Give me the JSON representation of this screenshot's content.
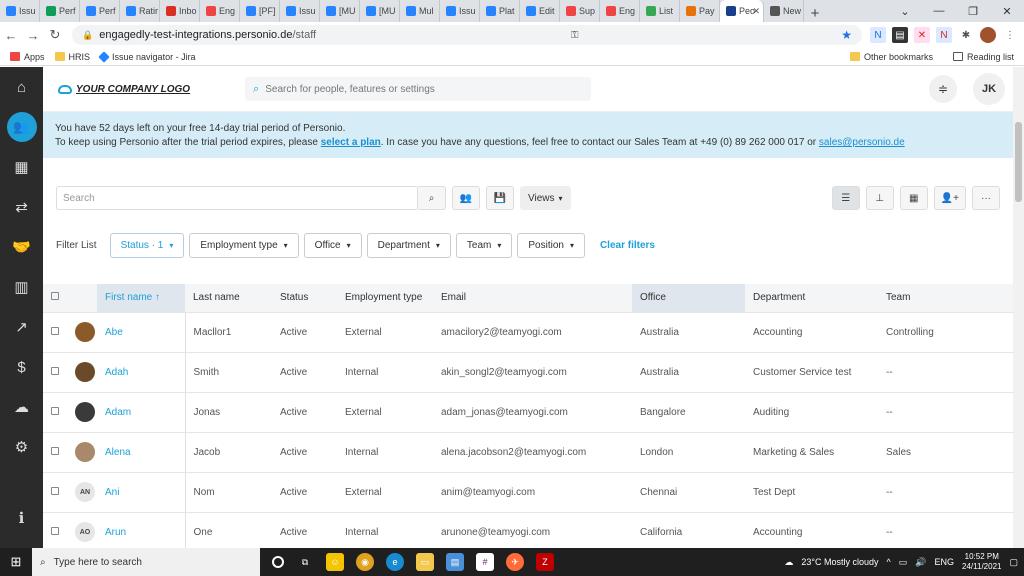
{
  "browser": {
    "tabs": [
      "Issu",
      "Perf",
      "Perf",
      "Ratir",
      "Inbo",
      "Eng",
      "[PF]",
      "Issu",
      "[MU",
      "[MU",
      "Mul",
      "Issu",
      "Plat",
      "Edit",
      "Sup",
      "Eng",
      "List",
      "Pay",
      "Peo",
      "New"
    ],
    "url_domain": "engagedly-test-integrations.personio.de",
    "url_path": "/staff",
    "bookmarks": [
      "Apps",
      "HRIS",
      "Issue navigator - Jira"
    ],
    "other_bookmarks": "Other bookmarks",
    "reading_list": "Reading list"
  },
  "header": {
    "logo": "YOUR COMPANY LOGO",
    "search_placeholder": "Search for people, features or settings",
    "user_initials": "JK"
  },
  "banner": {
    "line1": "You have 52 days left on your free 14-day trial period of Personio.",
    "line2_a": "To keep using Personio after the trial period expires, please ",
    "link_plan": "select a plan",
    "line2_b": ". In case you have any questions, feel free to contact our Sales Team at +49 (0) 89 262 000 017 or ",
    "link_email": "sales@personio.de"
  },
  "toolbar": {
    "search_placeholder": "Search",
    "views_label": "Views"
  },
  "filters": {
    "label": "Filter List",
    "chips": [
      "Status · 1",
      "Employment type",
      "Office",
      "Department",
      "Team",
      "Position"
    ],
    "clear": "Clear filters"
  },
  "table": {
    "columns": [
      "First name",
      "Last name",
      "Status",
      "Employment type",
      "Email",
      "Office",
      "Department",
      "Team"
    ],
    "rows": [
      {
        "avatar": "",
        "first": "Abe",
        "last": "Macllor1",
        "status": "Active",
        "type": "External",
        "email": "amacilory2@teamyogi.com",
        "office": "Australia",
        "dept": "Accounting",
        "team": "Controlling"
      },
      {
        "avatar": "",
        "first": "Adah",
        "last": "Smith",
        "status": "Active",
        "type": "Internal",
        "email": "akin_songl2@teamyogi.com",
        "office": "Australia",
        "dept": "Customer Service test",
        "team": "--"
      },
      {
        "avatar": "",
        "first": "Adam",
        "last": "Jonas",
        "status": "Active",
        "type": "External",
        "email": "adam_jonas@teamyogi.com",
        "office": "Bangalore",
        "dept": "Auditing",
        "team": "--"
      },
      {
        "avatar": "",
        "first": "Alena",
        "last": "Jacob",
        "status": "Active",
        "type": "Internal",
        "email": "alena.jacobson2@teamyogi.com",
        "office": "London",
        "dept": "Marketing & Sales",
        "team": "Sales"
      },
      {
        "avatar": "AN",
        "first": "Ani",
        "last": "Nom",
        "status": "Active",
        "type": "External",
        "email": "anim@teamyogi.com",
        "office": "Chennai",
        "dept": "Test Dept",
        "team": "--"
      },
      {
        "avatar": "AO",
        "first": "Arun",
        "last": "One",
        "status": "Active",
        "type": "Internal",
        "email": "arunone@teamyogi.com",
        "office": "California",
        "dept": "Accounting",
        "team": "--"
      }
    ]
  },
  "taskbar": {
    "search": "Type here to search",
    "weather": "23°C  Mostly cloudy",
    "lang": "ENG",
    "time": "10:52 PM",
    "date": "24/11/2021"
  }
}
